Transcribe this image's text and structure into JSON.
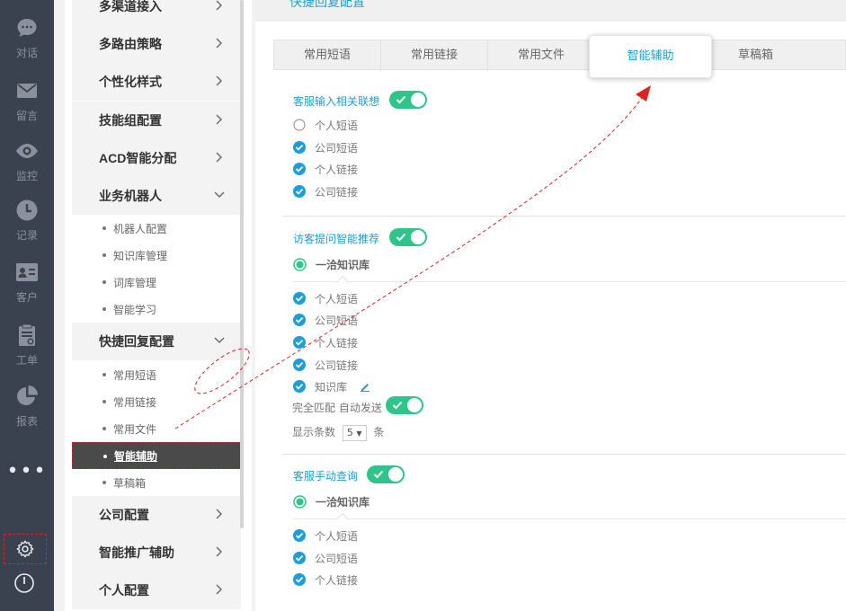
{
  "rail": {
    "items": [
      {
        "label": "对话",
        "icon": "chat-icon"
      },
      {
        "label": "留言",
        "icon": "mail-icon"
      },
      {
        "label": "监控",
        "icon": "eye-icon"
      },
      {
        "label": "记录",
        "icon": "clock-icon"
      },
      {
        "label": "客户",
        "icon": "contact-card-icon"
      },
      {
        "label": "工单",
        "icon": "clipboard-icon"
      },
      {
        "label": "报表",
        "icon": "pie-chart-icon"
      }
    ],
    "more": "•••"
  },
  "menu": {
    "groups": {
      "g1": "多渠道接入",
      "g2": "多路由策略",
      "g3": "个性化样式",
      "g4": "技能组配置",
      "g5": "ACD智能分配",
      "g6": "业务机器人",
      "g7": "快捷回复配置",
      "g8": "公司配置",
      "g9": "智能推广辅助",
      "g10": "个人配置"
    },
    "robot_items": [
      "机器人配置",
      "知识库管理",
      "词库管理",
      "智能学习"
    ],
    "quick_items": [
      "常用短语",
      "常用链接",
      "常用文件",
      "智能辅助",
      "草稿箱"
    ]
  },
  "main": {
    "title": "快捷回复配置",
    "tabs": [
      "常用短语",
      "常用链接",
      "常用文件",
      "智能辅助",
      "草稿箱"
    ],
    "sec1": {
      "title": "客服输入相关联想",
      "options": [
        "个人短语",
        "公司短语",
        "个人链接",
        "公司链接"
      ]
    },
    "sec2": {
      "title": "访客提问智能推荐",
      "kb": "一洽知识库",
      "options": [
        "个人短语",
        "公司短语",
        "个人链接",
        "公司链接",
        "知识库"
      ],
      "exact_match": "完全匹配 自动发送",
      "show_count_prefix": "显示条数",
      "show_count_value": "5",
      "show_count_suffix": "条"
    },
    "sec3": {
      "title": "客服手动查询",
      "kb": "一洽知识库",
      "options": [
        "个人短语",
        "公司短语",
        "个人链接"
      ]
    }
  },
  "colors": {
    "accent": "#1fa0c8",
    "toggle_on": "#2ec48a",
    "rail_bg": "#3a4250",
    "annotation": "#dd2222"
  }
}
